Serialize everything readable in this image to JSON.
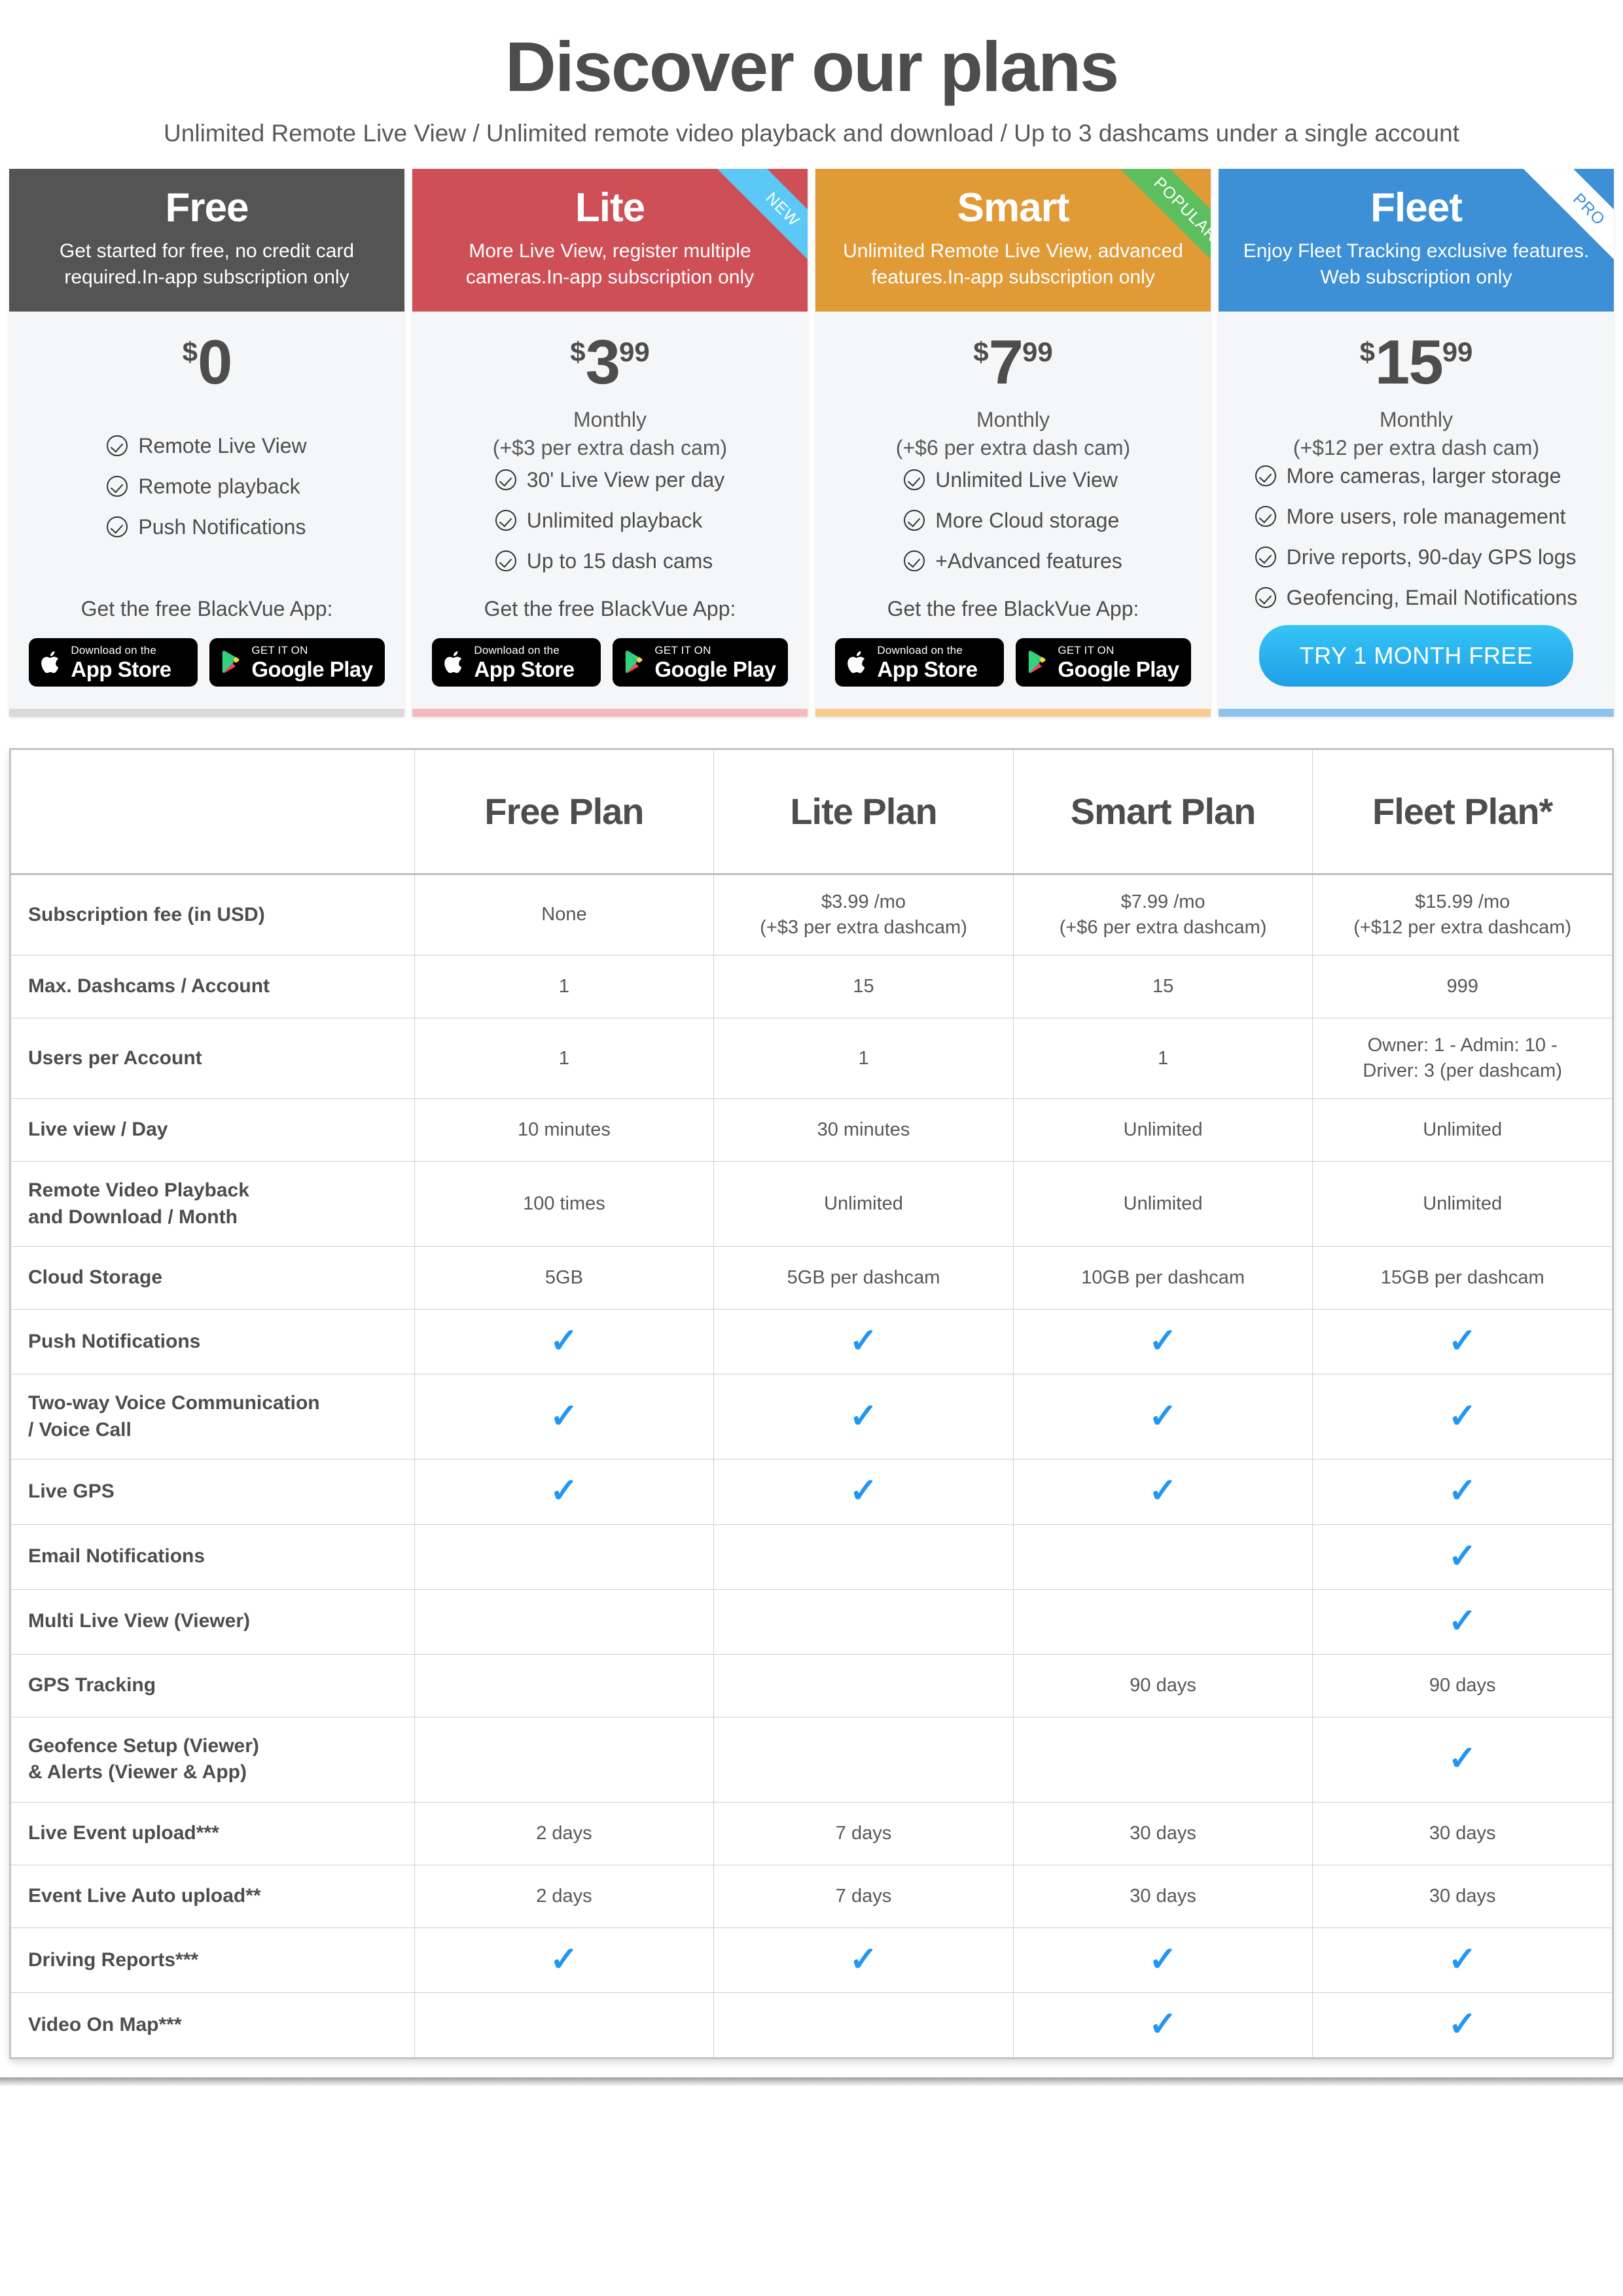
{
  "header": {
    "title": "Discover our plans",
    "subtitle": "Unlimited Remote Live View / Unlimited remote video playback and download / Up to 3 dashcams under a single account"
  },
  "app_cta_label": "Get the free BlackVue App:",
  "store_badges": {
    "apple": {
      "small": "Download on the",
      "big": "App Store",
      "icon": "apple-logo-icon"
    },
    "google": {
      "small": "GET IT ON",
      "big": "Google Play",
      "icon": "google-play-logo-icon"
    }
  },
  "plans": [
    {
      "key": "free",
      "name": "Free",
      "description": "Get started for free, no credit card required.In-app subscription only",
      "header_color": "#545454",
      "accent_color": "#d9d9d9",
      "ribbon": null,
      "price": {
        "currency": "$",
        "amount": "0",
        "cents": ""
      },
      "price_note": "",
      "features": [
        "Remote Live View",
        "Remote playback",
        "Push Notifications"
      ],
      "cta_type": "stores"
    },
    {
      "key": "lite",
      "name": "Lite",
      "description": "More Live View, register multiple cameras.In-app subscription only",
      "header_color": "#cf4f56",
      "accent_color": "#f3b9bd",
      "ribbon": {
        "label": "NEW",
        "bg": "#5bc8f5",
        "fg": "#ffffff"
      },
      "price": {
        "currency": "$",
        "amount": "3",
        "cents": "99"
      },
      "price_note": "Monthly\n(+$3 per extra dash cam)",
      "features": [
        "30' Live View per day",
        "Unlimited playback",
        "Up to 15 dash cams"
      ],
      "cta_type": "stores"
    },
    {
      "key": "smart",
      "name": "Smart",
      "description": "Unlimited Remote Live View, advanced features.In-app subscription only",
      "header_color": "#e09a36",
      "accent_color": "#f6cd8e",
      "ribbon": {
        "label": "POPULAR",
        "bg": "#5cbe5c",
        "fg": "#ffffff"
      },
      "price": {
        "currency": "$",
        "amount": "7",
        "cents": "99"
      },
      "price_note": "Monthly\n(+$6 per extra dash cam)",
      "features": [
        "Unlimited Live View",
        "More Cloud storage",
        "+Advanced features"
      ],
      "cta_type": "stores"
    },
    {
      "key": "fleet",
      "name": "Fleet",
      "description": "Enjoy Fleet Tracking exclusive features. Web subscription only",
      "header_color": "#3d8fd6",
      "accent_color": "#8cc3ee",
      "ribbon": {
        "label": "PRO",
        "bg": "#ffffff",
        "fg": "#3d8fd6"
      },
      "price": {
        "currency": "$",
        "amount": "15",
        "cents": "99"
      },
      "price_note": "Monthly\n(+$12 per extra dash cam)",
      "features": [
        "More cameras, larger storage",
        "More users, role management",
        "Drive reports, 90-day GPS logs",
        "Geofencing, Email Notifications"
      ],
      "cta_type": "button",
      "cta_label": "TRY 1 MONTH FREE"
    }
  ],
  "comparison": {
    "columns": [
      "",
      "Free Plan",
      "Lite Plan",
      "Smart Plan",
      "Fleet Plan*"
    ],
    "rows": [
      {
        "label": "Subscription fee (in USD)",
        "tall": true,
        "cells": [
          "None",
          "$3.99 /mo\n(+$3 per extra dashcam)",
          "$7.99 /mo\n(+$6 per extra dashcam)",
          "$15.99 /mo\n(+$12 per extra dashcam)"
        ]
      },
      {
        "label": "Max. Dashcams / Account",
        "cells": [
          "1",
          "15",
          "15",
          "999"
        ]
      },
      {
        "label": "Users per Account",
        "tall": true,
        "cells": [
          "1",
          "1",
          "1",
          "Owner: 1 - Admin: 10 -\nDriver: 3 (per dashcam)"
        ]
      },
      {
        "label": "Live view / Day",
        "cells": [
          "10 minutes",
          "30 minutes",
          "Unlimited",
          "Unlimited"
        ]
      },
      {
        "label": "Remote Video Playback\nand Download / Month",
        "tall": true,
        "cells": [
          "100 times",
          "Unlimited",
          "Unlimited",
          "Unlimited"
        ]
      },
      {
        "label": "Cloud Storage",
        "cells": [
          "5GB",
          "5GB per dashcam",
          "10GB per dashcam",
          "15GB per dashcam"
        ]
      },
      {
        "label": "Push Notifications",
        "cells": [
          "check",
          "check",
          "check",
          "check"
        ]
      },
      {
        "label": "Two-way Voice Communication\n/ Voice Call",
        "tall": true,
        "cells": [
          "check",
          "check",
          "check",
          "check"
        ]
      },
      {
        "label": "Live GPS",
        "cells": [
          "check",
          "check",
          "check",
          "check"
        ]
      },
      {
        "label": "Email Notifications",
        "cells": [
          "",
          "",
          "",
          "check"
        ]
      },
      {
        "label": "Multi Live View (Viewer)",
        "cells": [
          "",
          "",
          "",
          "check"
        ]
      },
      {
        "label": "GPS Tracking",
        "cells": [
          "",
          "",
          "90 days",
          "90 days"
        ]
      },
      {
        "label": "Geofence Setup (Viewer)\n& Alerts (Viewer & App)",
        "tall": true,
        "cells": [
          "",
          "",
          "",
          "check"
        ]
      },
      {
        "label": "Live Event upload***",
        "cells": [
          "2 days",
          "7 days",
          "30 days",
          "30 days"
        ]
      },
      {
        "label": "Event Live Auto upload**",
        "cells": [
          "2 days",
          "7 days",
          "30 days",
          "30 days"
        ]
      },
      {
        "label": "Driving Reports***",
        "cells": [
          "check",
          "check",
          "check",
          "check"
        ]
      },
      {
        "label": "Video On Map***",
        "cells": [
          "",
          "",
          "check",
          "check"
        ]
      }
    ]
  },
  "colors": {
    "check_blue": "#2196f3",
    "title_gray": "#4d4d4d",
    "card_body_bg": "#f5f6f7"
  }
}
